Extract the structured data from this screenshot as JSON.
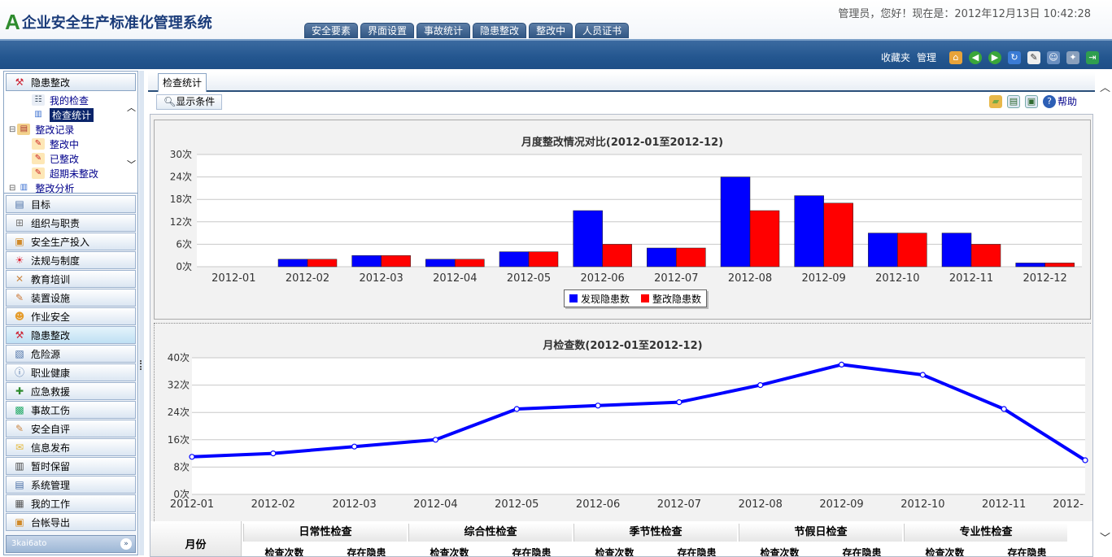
{
  "app": {
    "title": "企业安全生产标准化管理系统",
    "welcome": "管理员，您好！现在是：2012年12月13日  10:42:28"
  },
  "top_tabs": [
    "安全要素",
    "界面设置",
    "事故统计",
    "隐患整改",
    "整改中",
    "人员证书"
  ],
  "toolbar_top": {
    "favorites": "收藏夹",
    "manage": "管理",
    "icons": [
      "home-icon",
      "back-icon",
      "forward-icon",
      "refresh-icon",
      "edit-icon",
      "user-icon",
      "settings-icon",
      "exit-icon"
    ]
  },
  "sidebar": {
    "tree_title": "隐患整改",
    "tree": [
      {
        "label": "我的检查",
        "level": 2,
        "icon": "checklist-icon",
        "sel": false
      },
      {
        "label": "检查统计",
        "level": 2,
        "icon": "chart-icon",
        "sel": true
      },
      {
        "label": "整改记录",
        "level": 1,
        "icon": "folder-icon",
        "sel": false
      },
      {
        "label": "整改中",
        "level": 2,
        "icon": "task-icon",
        "sel": false
      },
      {
        "label": "已整改",
        "level": 2,
        "icon": "task-icon",
        "sel": false
      },
      {
        "label": "超期未整改",
        "level": 2,
        "icon": "task-icon",
        "sel": false
      },
      {
        "label": "整改分析",
        "level": 1,
        "icon": "chart-icon",
        "sel": false
      }
    ],
    "menu": [
      "目标",
      "组织与职责",
      "安全生产投入",
      "法规与制度",
      "教育培训",
      "装置设施",
      "作业安全",
      "隐患整改",
      "危险源",
      "职业健康",
      "应急救援",
      "事故工伤",
      "安全自评",
      "信息发布",
      "暂时保留",
      "系统管理",
      "我的工作",
      "台帐导出"
    ],
    "active_menu": "隐患整改",
    "footer": "3kai6ato"
  },
  "content": {
    "tab": "检查统计",
    "show_conditions": "显示条件",
    "help": "帮助"
  },
  "chart_data": [
    {
      "type": "bar",
      "title": "月度整改情况对比(2012-01至2012-12)",
      "categories": [
        "2012-01",
        "2012-02",
        "2012-03",
        "2012-04",
        "2012-05",
        "2012-06",
        "2012-07",
        "2012-08",
        "2012-09",
        "2012-10",
        "2012-11",
        "2012-12"
      ],
      "series": [
        {
          "name": "发现隐患数",
          "color": "#0000ff",
          "values": [
            0,
            2,
            3,
            2,
            4,
            15,
            5,
            24,
            19,
            9,
            9,
            1
          ]
        },
        {
          "name": "整改隐患数",
          "color": "#ff0000",
          "values": [
            0,
            2,
            3,
            2,
            4,
            6,
            5,
            15,
            17,
            9,
            6,
            1
          ]
        }
      ],
      "ylim": [
        0,
        30
      ],
      "yticks": [
        "0次",
        "6次",
        "12次",
        "18次",
        "24次",
        "30次"
      ],
      "legend": "bottom-center",
      "grid": true
    },
    {
      "type": "line",
      "title": "月检查数(2012-01至2012-12)",
      "categories": [
        "2012-01",
        "2012-02",
        "2012-03",
        "2012-04",
        "2012-05",
        "2012-06",
        "2012-07",
        "2012-08",
        "2012-09",
        "2012-10",
        "2012-11",
        "2012-"
      ],
      "series": [
        {
          "name": "",
          "color": "#0000ff",
          "values": [
            11,
            12,
            14,
            16,
            25,
            26,
            27,
            32,
            38,
            35,
            25,
            10
          ]
        }
      ],
      "ylim": [
        0,
        40
      ],
      "yticks": [
        "0次",
        "8次",
        "16次",
        "24次",
        "32次",
        "40次"
      ],
      "grid": true
    }
  ],
  "table": {
    "month_header": "月份",
    "groups": [
      "日常性检查",
      "综合性检查",
      "季节性检查",
      "节假日检查",
      "专业性检查"
    ],
    "sub_headers": [
      "检查次数",
      "存在隐患"
    ]
  }
}
